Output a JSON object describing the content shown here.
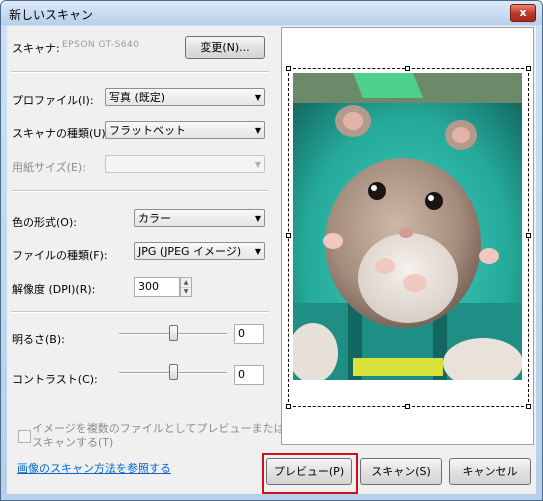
{
  "window": {
    "title": "新しいスキャン",
    "close_glyph": "x"
  },
  "scanner": {
    "label": "スキャナ:",
    "name": "EPSON GT-S640",
    "change_button": "変更(N)..."
  },
  "profile": {
    "label": "プロファイル(I):",
    "value": "写真 (既定)"
  },
  "source": {
    "label": "スキャナの種類(U):",
    "value": "フラットベット"
  },
  "paper_size": {
    "label": "用紙サイズ(E):",
    "value": ""
  },
  "color_format": {
    "label": "色の形式(O):",
    "value": "カラー"
  },
  "file_type": {
    "label": "ファイルの種類(F):",
    "value": "JPG (JPEG イメージ)"
  },
  "resolution": {
    "label": "解像度 (DPI)(R):",
    "value": "300"
  },
  "brightness": {
    "label": "明るさ(B):",
    "value": "0",
    "level_fraction": 0.5
  },
  "contrast": {
    "label": "コントラスト(C):",
    "value": "0",
    "level_fraction": 0.5
  },
  "multi_file_checkbox": {
    "label_line1": "イメージを複数のファイルとしてプレビューまたは",
    "label_line2": "スキャンする(T)",
    "checked": false
  },
  "help_link": "画像のスキャン方法を参照する",
  "buttons": {
    "preview": "プレビュー(P)",
    "scan": "スキャン(S)",
    "cancel": "キャンセル"
  },
  "colors": {
    "highlight": "#d0111b",
    "link": "#0066cc",
    "close_button": "#c0392b"
  }
}
